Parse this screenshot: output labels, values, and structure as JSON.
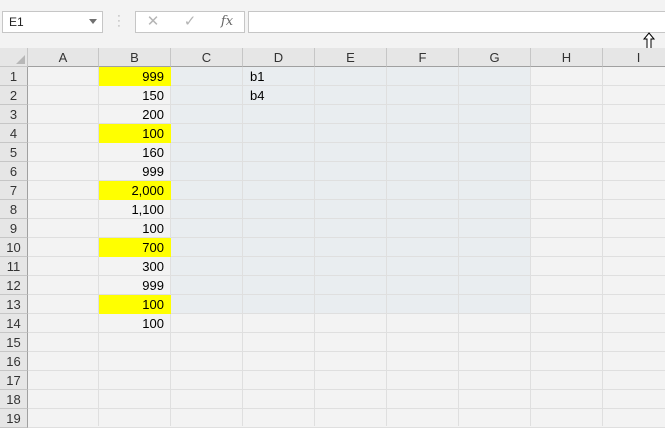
{
  "formula_bar": {
    "name_box": "E1",
    "cancel_glyph": "✕",
    "enter_glyph": "✓",
    "fx_label": "fx",
    "formula": ""
  },
  "columns": [
    "A",
    "B",
    "C",
    "D",
    "E",
    "F",
    "G",
    "H",
    "I"
  ],
  "rows": [
    "1",
    "2",
    "3",
    "4",
    "5",
    "6",
    "7",
    "8",
    "9",
    "10",
    "11",
    "12",
    "13",
    "14",
    "15",
    "16",
    "17",
    "18",
    "19"
  ],
  "column_b": [
    {
      "value": "999",
      "highlight": true
    },
    {
      "value": "150",
      "highlight": false
    },
    {
      "value": "200",
      "highlight": false
    },
    {
      "value": "100",
      "highlight": true
    },
    {
      "value": "160",
      "highlight": false
    },
    {
      "value": "999",
      "highlight": false
    },
    {
      "value": "2,000",
      "highlight": true
    },
    {
      "value": "1,100",
      "highlight": false
    },
    {
      "value": "100",
      "highlight": false
    },
    {
      "value": "700",
      "highlight": true
    },
    {
      "value": "300",
      "highlight": false
    },
    {
      "value": "999",
      "highlight": false
    },
    {
      "value": "100",
      "highlight": true
    },
    {
      "value": "100",
      "highlight": false
    }
  ],
  "column_d": [
    "b1",
    "b4"
  ],
  "colors": {
    "highlight": "#ffff00",
    "selection": "#e9edf0"
  }
}
